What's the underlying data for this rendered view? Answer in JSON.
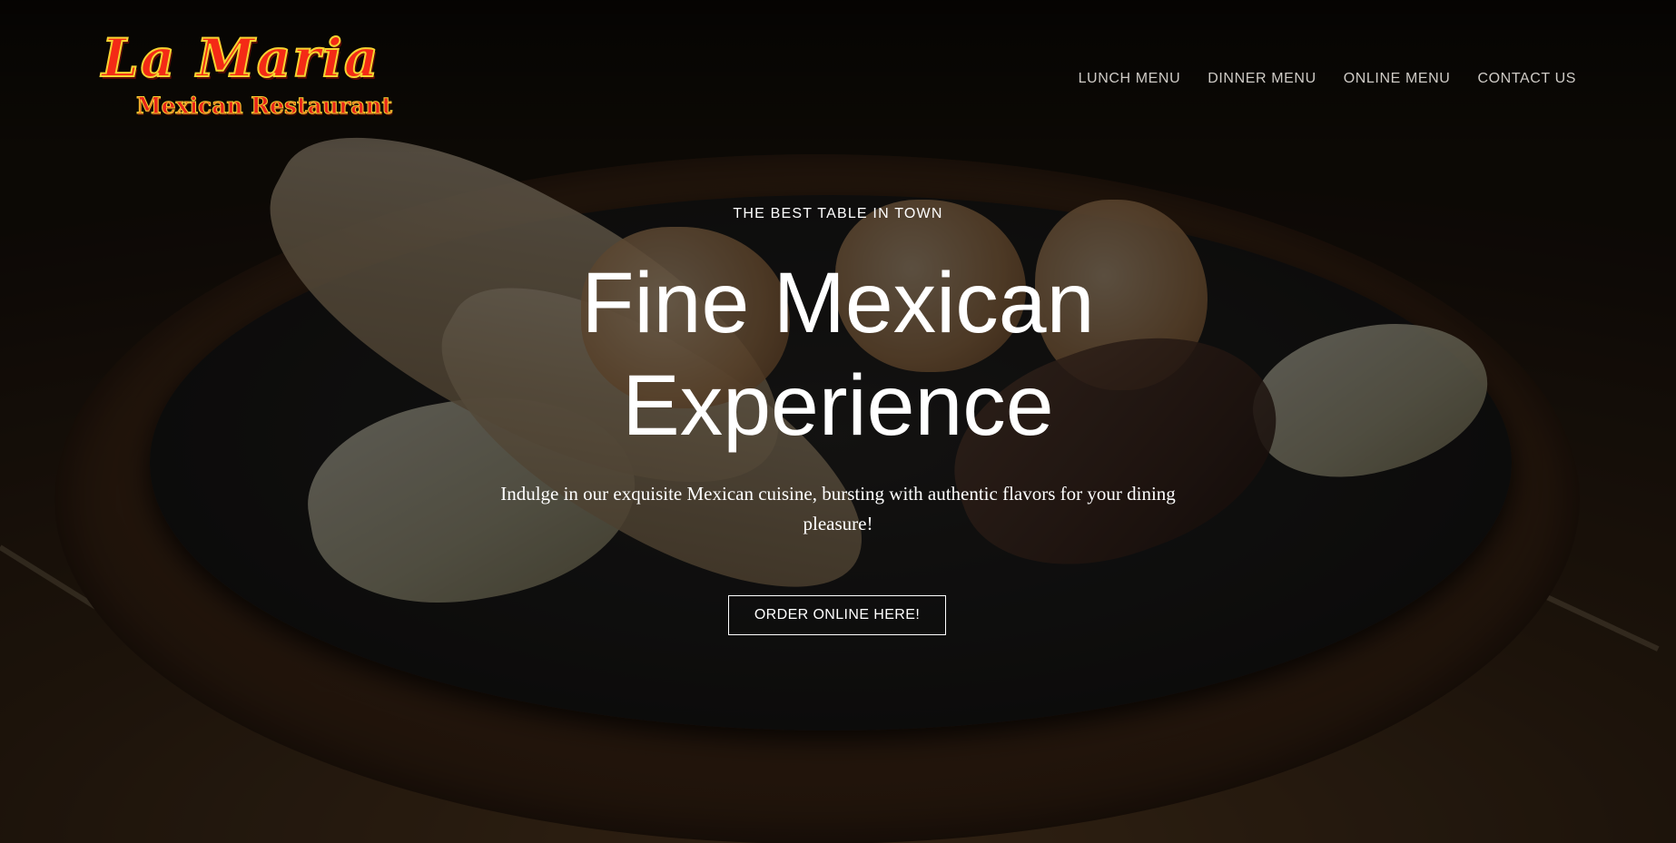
{
  "brand": {
    "logo_script": "La Maria",
    "logo_subtitle": "Mexican Restaurant"
  },
  "nav": {
    "items": [
      {
        "label": "LUNCH MENU"
      },
      {
        "label": "DINNER MENU"
      },
      {
        "label": "ONLINE MENU"
      },
      {
        "label": "CONTACT US"
      }
    ]
  },
  "hero": {
    "eyebrow": "THE BEST TABLE IN TOWN",
    "headline": "Fine Mexican Experience",
    "subtext": "Indulge in our exquisite Mexican cuisine, bursting with authentic flavors for your dining pleasure!",
    "cta_label": "ORDER ONLINE HERE!"
  },
  "colors": {
    "logo_red": "#f42a16",
    "logo_yellow": "#f6d330",
    "nav_text": "#cfcbc6",
    "hero_text": "#ffffff"
  }
}
